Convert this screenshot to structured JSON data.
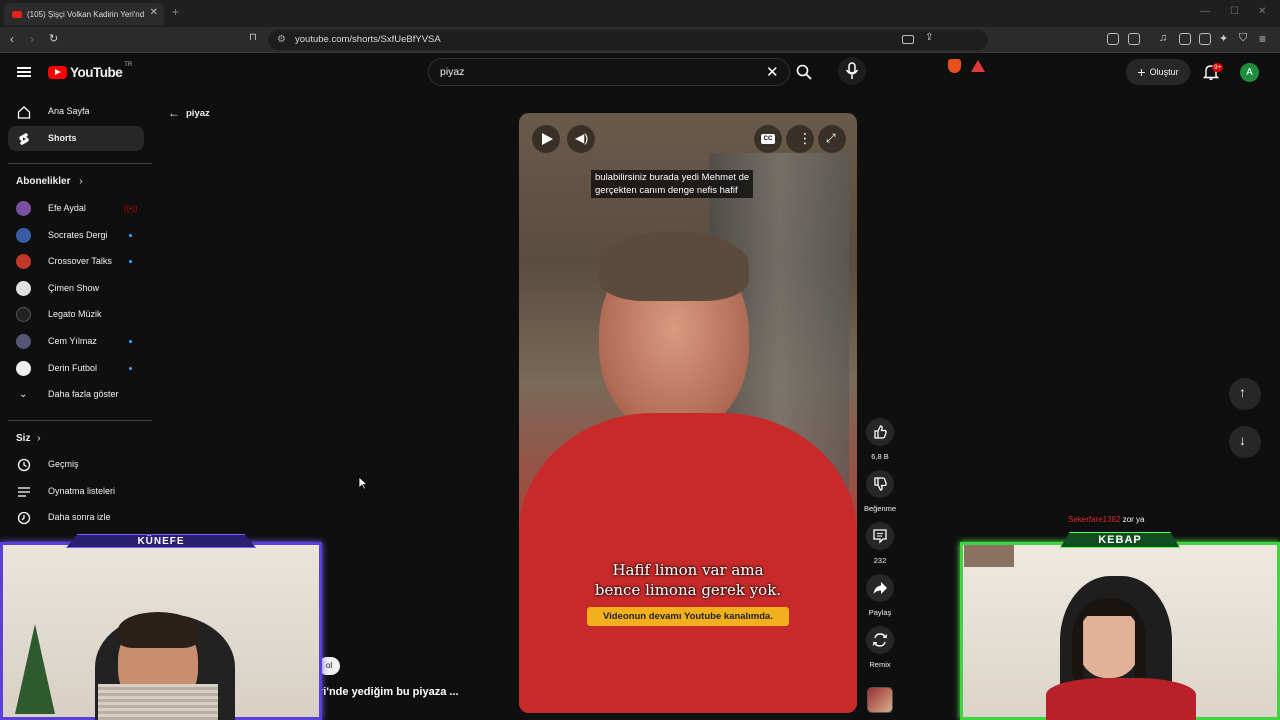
{
  "browser": {
    "tab_title": "(105) Şişçi Volkan Kadirin Yeri'nd",
    "url": "youtube.com/shorts/SxfUeBfYVSA"
  },
  "header": {
    "logo_text": "YouTube",
    "country": "TR",
    "search_value": "piyaz",
    "create_label": "Oluştur",
    "notification_badge": "9+",
    "avatar_letter": "A"
  },
  "sidebar": {
    "items": [
      {
        "label": "Ana Sayfa",
        "icon": "home-icon"
      },
      {
        "label": "Shorts",
        "icon": "shorts-icon",
        "active": true
      }
    ],
    "subscriptions_title": "Abonelikler",
    "subscriptions": [
      {
        "label": "Efe Aydal",
        "color": "#7a4fa0",
        "live": true
      },
      {
        "label": "Socrates Dergi",
        "color": "#3b5ba5",
        "dot": true
      },
      {
        "label": "Crossover Talks",
        "color": "#c0392b",
        "dot": true
      },
      {
        "label": "Çimen Show",
        "color": "#e0e0e0",
        "dot": false
      },
      {
        "label": "Legato Müzik",
        "color": "#222222",
        "dot": false
      },
      {
        "label": "Cem Yılmaz",
        "color": "#555577",
        "dot": true
      },
      {
        "label": "Derin Futbol",
        "color": "#eeeeee",
        "dot": true
      }
    ],
    "show_more": "Daha fazla göster",
    "you_title": "Siz",
    "you_items": [
      {
        "label": "Geçmiş",
        "icon": "history-icon"
      },
      {
        "label": "Oynatma listeleri",
        "icon": "playlist-icon"
      },
      {
        "label": "Daha sonra izle",
        "icon": "watch-later-icon"
      }
    ]
  },
  "back_label": "piyaz",
  "video": {
    "top_caption_line1": "bulabilirsiniz burada yedi Mehmet de",
    "top_caption_line2": "gerçekten canım denge nefis hafif",
    "burned_line1": "Hafif limon var ama",
    "burned_line2": "bence limona gerek yok.",
    "banner": "Videonun devamı Youtube kanalımda.",
    "title_fragment": "ri'nde yediğim bu piyaza ...",
    "chip": "ol"
  },
  "actions": {
    "likes": "6,8 B",
    "dislike": "Beğenme",
    "comments": "232",
    "share": "Paylaş",
    "remix": "Remix"
  },
  "overlay": {
    "left_cam_label": "KÜNEFE",
    "right_cam_label": "KEBAP",
    "chat_user": "Sekerfare1382",
    "chat_text": "zor ya"
  }
}
